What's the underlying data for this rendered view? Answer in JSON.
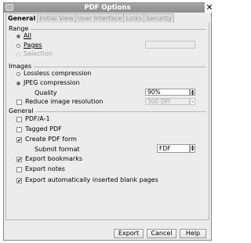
{
  "window": {
    "title": "PDF Options",
    "close_label": "✕"
  },
  "tabs": [
    "General",
    "Initial View",
    "User Interface",
    "Links",
    "Security"
  ],
  "range": {
    "heading": "Range",
    "all_label": "All",
    "pages_label": "Pages",
    "selection_label": "Selection"
  },
  "images": {
    "heading": "Images",
    "lossless_label": "Lossless compression",
    "jpeg_label": "JPEG compression",
    "quality_label": "Quality",
    "quality_value": "90%",
    "reduce_label": "Reduce image resolution",
    "resolution_value": "300 DPI"
  },
  "general": {
    "heading": "General",
    "pdfa_label": "PDF/A-1",
    "tagged_label": "Tagged PDF",
    "create_form_label": "Create PDF form",
    "submit_format_label": "Submit format",
    "submit_format_value": "FDF",
    "bookmarks_label": "Export bookmarks",
    "notes_label": "Export notes",
    "blank_pages_label": "Export automatically inserted blank pages"
  },
  "buttons": {
    "export": "Export",
    "cancel": "Cancel",
    "help": "Help"
  }
}
